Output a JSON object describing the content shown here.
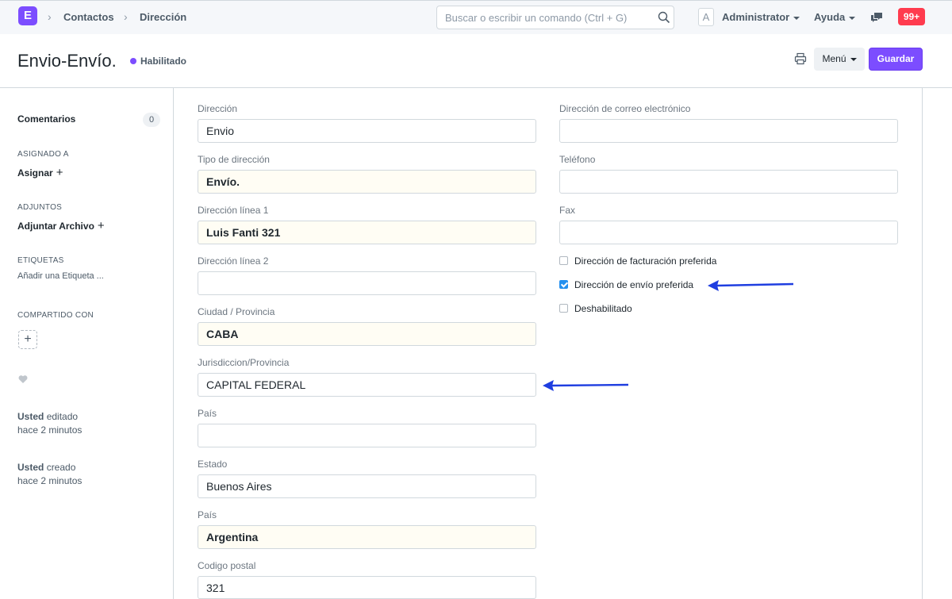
{
  "navbar": {
    "logo": "E",
    "breadcrumbs": [
      "Contactos",
      "Dirección"
    ],
    "search_placeholder": "Buscar o escribir un comando (Ctrl + G)",
    "avatar_letter": "A",
    "user_menu": "Administrator",
    "help_menu": "Ayuda",
    "notifications": "99+"
  },
  "page": {
    "title": "Envio-Envío.",
    "status": "Habilitado",
    "menu_label": "Menú",
    "save_label": "Guardar"
  },
  "sidebar": {
    "comments_label": "Comentarios",
    "comments_count": "0",
    "assigned_heading": "ASIGNADO A",
    "assign_action": "Asignar",
    "attachments_heading": "ADJUNTOS",
    "attach_action": "Adjuntar Archivo",
    "tags_heading": "ETIQUETAS",
    "add_tag": "Añadir una Etiqueta ...",
    "shared_heading": "COMPARTIDO CON",
    "activity": [
      {
        "who": "Usted",
        "action": "editado",
        "when": "hace 2 minutos"
      },
      {
        "who": "Usted",
        "action": "creado",
        "when": "hace 2 minutos"
      }
    ]
  },
  "form": {
    "left": [
      {
        "label": "Dirección",
        "value": "Envio",
        "bold": false
      },
      {
        "label": "Tipo de dirección",
        "value": "Envío.",
        "bold": true
      },
      {
        "label": "Dirección línea 1",
        "value": "Luis Fanti 321",
        "bold": true
      },
      {
        "label": "Dirección línea 2",
        "value": "",
        "bold": false
      },
      {
        "label": "Ciudad / Provincia",
        "value": "CABA",
        "bold": true
      },
      {
        "label": "Jurisdiccion/Provincia",
        "value": "CAPITAL FEDERAL",
        "bold": false
      },
      {
        "label": "País",
        "value": "",
        "bold": false
      },
      {
        "label": "Estado",
        "value": "Buenos Aires",
        "bold": false
      },
      {
        "label": "País",
        "value": "Argentina",
        "bold": true
      },
      {
        "label": "Codigo postal",
        "value": "321",
        "bold": false
      }
    ],
    "right": [
      {
        "label": "Dirección de correo electrónico",
        "value": ""
      },
      {
        "label": "Teléfono",
        "value": ""
      },
      {
        "label": "Fax",
        "value": ""
      }
    ],
    "checkboxes": [
      {
        "label": "Dirección de facturación preferida",
        "checked": false
      },
      {
        "label": "Dirección de envío preferida",
        "checked": true
      },
      {
        "label": "Deshabilitado",
        "checked": false
      }
    ]
  },
  "colors": {
    "accent": "#7c4dff",
    "annotation_arrow": "#1f3ee0",
    "badge": "#ff3b4e"
  }
}
